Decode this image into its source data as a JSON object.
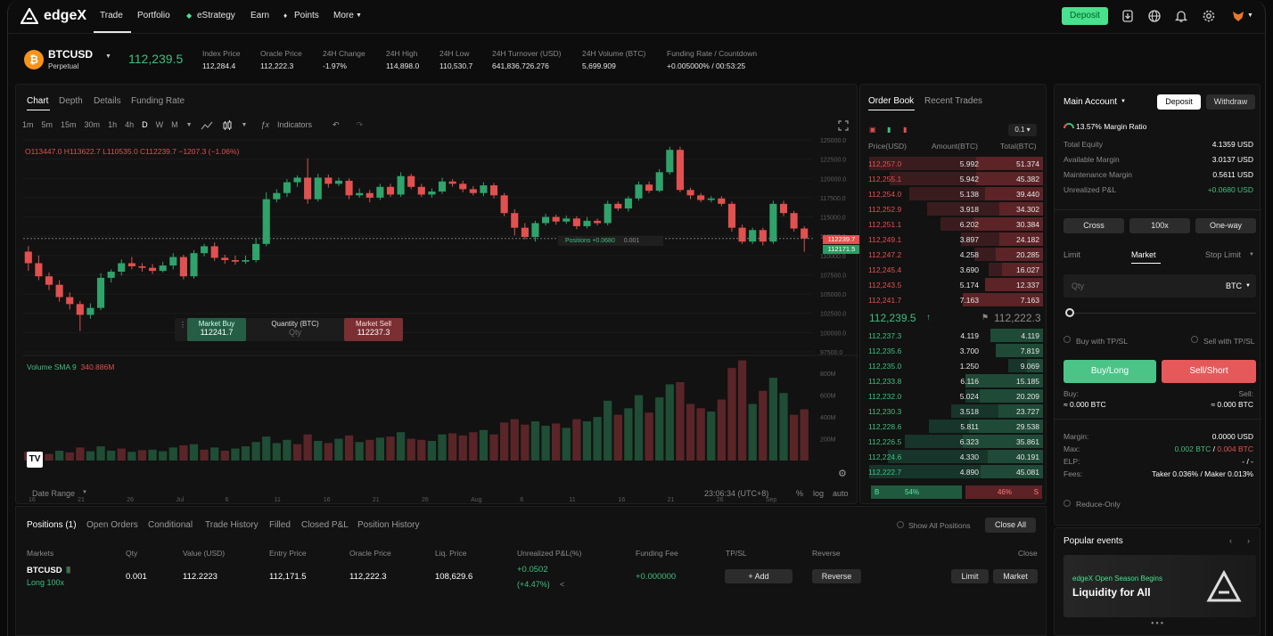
{
  "nav": {
    "logo": "edgeX",
    "items": [
      "Trade",
      "Portfolio",
      "eStrategy",
      "Earn",
      "Points",
      "More"
    ],
    "deposit": "Deposit"
  },
  "ticker": {
    "symbol": "BTCUSD",
    "sub": "Perpetual",
    "price": "112,239.5",
    "stats": [
      {
        "label": "Index Price",
        "value": "112,284.4"
      },
      {
        "label": "Oracle Price",
        "value": "112,222.3"
      },
      {
        "label": "24H Change",
        "value": "-1.97%"
      },
      {
        "label": "24H High",
        "value": "114,898.0"
      },
      {
        "label": "24H Low",
        "value": "110,530.7"
      },
      {
        "label": "24H Turnover (USD)",
        "value": "641,836,726.276"
      },
      {
        "label": "24H Volume (BTC)",
        "value": "5,699.909"
      },
      {
        "label": "Funding Rate / Countdown",
        "value": "+0.005000% / 00:53:25"
      }
    ]
  },
  "chart": {
    "tabs": [
      "Chart",
      "Depth",
      "Details",
      "Funding Rate"
    ],
    "intervals": [
      "1m",
      "5m",
      "15m",
      "30m",
      "1h",
      "4h",
      "D",
      "W",
      "M"
    ],
    "indicators": "Indicators",
    "ohlc": "O113447.0 H113622.7 L110535.0 C112239.7 −1207.3 (−1.06%)",
    "volume_label": "Volume SMA 9",
    "volume_value": "340.886M",
    "positions_label": "Positions +0.0680",
    "positions_qty": "0.001",
    "price_tag_1": "112239.7",
    "price_tag_2": "112171.5",
    "price_axis": [
      "125000.0",
      "122500.0",
      "120000.0",
      "117500.0",
      "115000.0",
      "112500.0",
      "110000.0",
      "107500.0",
      "105000.0",
      "102500.0",
      "100000.0",
      "97500.0"
    ],
    "vol_axis": [
      "800M",
      "600M",
      "400M",
      "200M"
    ],
    "date_axis": [
      "16",
      "21",
      "26",
      "Jul",
      "6",
      "11",
      "16",
      "21",
      "26",
      "Aug",
      "6",
      "11",
      "16",
      "21",
      "26",
      "Sep"
    ],
    "quick_trade": {
      "buy_label": "Market Buy",
      "buy_price": "112241.7",
      "qty_label": "Quantity (BTC)",
      "qty_placeholder": "Qty",
      "sell_label": "Market Sell",
      "sell_price": "112237.3"
    },
    "date_range": "Date Range",
    "time": "23:06:34 (UTC+8)",
    "percent": "%",
    "log": "log",
    "auto": "auto"
  },
  "chart_data": {
    "type": "candlestick",
    "ylim": [
      97500,
      125000
    ],
    "candles": [
      [
        110500,
        109000,
        111200,
        108000
      ],
      [
        109000,
        107300,
        110000,
        106800
      ],
      [
        107300,
        106200,
        107800,
        105500
      ],
      [
        106200,
        104600,
        106800,
        104000
      ],
      [
        104600,
        103700,
        105200,
        103000
      ],
      [
        103700,
        102300,
        104100,
        100200
      ],
      [
        102300,
        103200,
        103800,
        101800
      ],
      [
        103200,
        107100,
        107700,
        102900
      ],
      [
        107100,
        107900,
        108200,
        106500
      ],
      [
        107900,
        109000,
        109500,
        107400
      ],
      [
        109000,
        108600,
        109800,
        108200
      ],
      [
        108600,
        108400,
        109000,
        107900
      ],
      [
        108400,
        108000,
        108900,
        107600
      ],
      [
        108000,
        108700,
        109200,
        107800
      ],
      [
        108700,
        109800,
        110300,
        108200
      ],
      [
        109800,
        107300,
        110100,
        106900
      ],
      [
        107300,
        110300,
        110700,
        107000
      ],
      [
        110300,
        111200,
        111500,
        109900
      ],
      [
        111200,
        109700,
        111700,
        109300
      ],
      [
        109700,
        109400,
        110100,
        108900
      ],
      [
        109400,
        109200,
        110000,
        108800
      ],
      [
        109200,
        109400,
        110000,
        108900
      ],
      [
        109400,
        111500,
        112200,
        109100
      ],
      [
        111500,
        117300,
        118200,
        111200
      ],
      [
        117300,
        118100,
        118600,
        116900
      ],
      [
        118100,
        119500,
        119900,
        117600
      ],
      [
        119500,
        120100,
        120400,
        118900
      ],
      [
        120100,
        117300,
        122600,
        116700
      ],
      [
        117300,
        120100,
        120600,
        117000
      ],
      [
        120100,
        119300,
        120500,
        118800
      ],
      [
        119300,
        119700,
        120100,
        119000
      ],
      [
        119700,
        117800,
        120000,
        117300
      ],
      [
        117800,
        118100,
        118700,
        117500
      ],
      [
        118100,
        117500,
        118500,
        116900
      ],
      [
        117500,
        118900,
        119300,
        117200
      ],
      [
        118900,
        117900,
        119300,
        117600
      ],
      [
        117900,
        120300,
        120800,
        117600
      ],
      [
        120300,
        118900,
        120600,
        118600
      ],
      [
        118900,
        117900,
        119300,
        117600
      ],
      [
        117900,
        118300,
        118700,
        117500
      ],
      [
        118300,
        119600,
        120100,
        118000
      ],
      [
        119600,
        119300,
        119900,
        118900
      ],
      [
        119300,
        118600,
        119700,
        118200
      ],
      [
        118600,
        118100,
        119000,
        117800
      ],
      [
        118100,
        119100,
        119500,
        117700
      ],
      [
        119100,
        117800,
        119400,
        117400
      ],
      [
        117800,
        115500,
        118100,
        115100
      ],
      [
        115500,
        113600,
        116000,
        112600
      ],
      [
        113600,
        112400,
        114200,
        112100
      ],
      [
        112400,
        114200,
        114500,
        111800
      ],
      [
        114200,
        115000,
        115400,
        113900
      ],
      [
        115000,
        114400,
        115300,
        114000
      ],
      [
        114400,
        114800,
        115200,
        114100
      ],
      [
        114800,
        113800,
        115100,
        113400
      ],
      [
        113800,
        114500,
        115000,
        113500
      ],
      [
        114500,
        114200,
        114800,
        113900
      ],
      [
        114200,
        116700,
        117100,
        113900
      ],
      [
        116700,
        116100,
        117000,
        115800
      ],
      [
        116100,
        117400,
        117700,
        115700
      ],
      [
        117400,
        119200,
        119600,
        117100
      ],
      [
        119200,
        118400,
        119600,
        118100
      ],
      [
        118400,
        120800,
        121200,
        118200
      ],
      [
        120800,
        123700,
        124100,
        120500
      ],
      [
        123700,
        118500,
        124100,
        118200
      ],
      [
        118500,
        117800,
        118800,
        117300
      ],
      [
        117800,
        117200,
        118100,
        116900
      ],
      [
        117200,
        117400,
        117700,
        116900
      ],
      [
        117400,
        116700,
        117700,
        116400
      ],
      [
        116700,
        113600,
        117000,
        113100
      ],
      [
        113600,
        111800,
        114000,
        111500
      ],
      [
        111800,
        113300,
        113600,
        111500
      ],
      [
        113300,
        111800,
        113600,
        111300
      ],
      [
        111800,
        116700,
        117100,
        111500
      ],
      [
        116700,
        115500,
        117100,
        115100
      ],
      [
        115500,
        113500,
        115800,
        113100
      ],
      [
        113500,
        112200,
        113800,
        110500
      ]
    ],
    "volumes": [
      [
        80,
        0
      ],
      [
        70,
        0
      ],
      [
        60,
        0
      ],
      [
        90,
        1
      ],
      [
        75,
        0
      ],
      [
        120,
        0
      ],
      [
        85,
        1
      ],
      [
        130,
        1
      ],
      [
        90,
        1
      ],
      [
        110,
        0
      ],
      [
        80,
        1
      ],
      [
        95,
        0
      ],
      [
        100,
        1
      ],
      [
        85,
        1
      ],
      [
        120,
        1
      ],
      [
        140,
        0
      ],
      [
        150,
        1
      ],
      [
        100,
        0
      ],
      [
        120,
        1
      ],
      [
        90,
        0
      ],
      [
        110,
        1
      ],
      [
        130,
        1
      ],
      [
        170,
        1
      ],
      [
        220,
        1
      ],
      [
        160,
        1
      ],
      [
        190,
        1
      ],
      [
        150,
        0
      ],
      [
        240,
        0
      ],
      [
        180,
        1
      ],
      [
        160,
        0
      ],
      [
        200,
        1
      ],
      [
        230,
        0
      ],
      [
        170,
        1
      ],
      [
        190,
        0
      ],
      [
        210,
        1
      ],
      [
        220,
        0
      ],
      [
        260,
        1
      ],
      [
        200,
        0
      ],
      [
        190,
        0
      ],
      [
        180,
        1
      ],
      [
        240,
        1
      ],
      [
        250,
        0
      ],
      [
        230,
        0
      ],
      [
        260,
        0
      ],
      [
        280,
        1
      ],
      [
        240,
        0
      ],
      [
        350,
        0
      ],
      [
        380,
        0
      ],
      [
        330,
        0
      ],
      [
        360,
        1
      ],
      [
        320,
        1
      ],
      [
        340,
        0
      ],
      [
        300,
        1
      ],
      [
        380,
        0
      ],
      [
        360,
        1
      ],
      [
        400,
        1
      ],
      [
        550,
        1
      ],
      [
        420,
        0
      ],
      [
        480,
        1
      ],
      [
        600,
        1
      ],
      [
        440,
        0
      ],
      [
        580,
        1
      ],
      [
        700,
        1
      ],
      [
        720,
        0
      ],
      [
        520,
        0
      ],
      [
        480,
        0
      ],
      [
        450,
        1
      ],
      [
        560,
        0
      ],
      [
        850,
        0
      ],
      [
        920,
        0
      ],
      [
        520,
        1
      ],
      [
        640,
        0
      ],
      [
        760,
        1
      ],
      [
        620,
        1
      ],
      [
        420,
        0
      ],
      [
        470,
        0
      ]
    ],
    "volume_ylim": [
      0,
      900
    ]
  },
  "orderbook": {
    "tabs": [
      "Order Book",
      "Recent Trades"
    ],
    "precision": "0.1",
    "headers": [
      "Price(USD)",
      "Amount(BTC)",
      "Total(BTC)"
    ],
    "asks": [
      [
        "112,257.0",
        "5.992",
        "51.374"
      ],
      [
        "112,255.1",
        "5.942",
        "45.382"
      ],
      [
        "112,254.0",
        "5.138",
        "39.440"
      ],
      [
        "112,252.9",
        "3.918",
        "34.302"
      ],
      [
        "112,251.1",
        "6.202",
        "30.384"
      ],
      [
        "112,249.1",
        "3.897",
        "24.182"
      ],
      [
        "112,247.2",
        "4.258",
        "20.285"
      ],
      [
        "112,245.4",
        "3.690",
        "16.027"
      ],
      [
        "112,243.5",
        "5.174",
        "12.337"
      ],
      [
        "112,241.7",
        "7.163",
        "7.163"
      ]
    ],
    "mid_price": "112,239.5",
    "mark_price": "112,222.3",
    "bids": [
      [
        "112,237.3",
        "4.119",
        "4.119"
      ],
      [
        "112,235.6",
        "3.700",
        "7.819"
      ],
      [
        "112,235.0",
        "1.250",
        "9.069"
      ],
      [
        "112,233.8",
        "6.116",
        "15.185"
      ],
      [
        "112,232.0",
        "5.024",
        "20.209"
      ],
      [
        "112,230.3",
        "3.518",
        "23.727"
      ],
      [
        "112,228.6",
        "5.811",
        "29.538"
      ],
      [
        "112,226.5",
        "6.323",
        "35.861"
      ],
      [
        "112,224.6",
        "4.330",
        "40.191"
      ],
      [
        "112,222.7",
        "4.890",
        "45.081"
      ]
    ],
    "ratio_buy": "54%",
    "ratio_sell": "46%",
    "ratio_b": "B",
    "ratio_s": "S",
    "ratio_buy_frac": 0.54
  },
  "account": {
    "title": "Main Account",
    "deposit": "Deposit",
    "withdraw": "Withdraw",
    "margin_ratio": "13.57% Margin Ratio",
    "rows": [
      {
        "label": "Total Equity",
        "value": "4.1359 USD"
      },
      {
        "label": "Available Margin",
        "value": "3.0137 USD"
      },
      {
        "label": "Maintenance Margin",
        "value": "0.5611 USD"
      },
      {
        "label": "Unrealized P&L",
        "value": "+0.0680 USD"
      }
    ]
  },
  "order_form": {
    "mode": [
      "Cross",
      "100x",
      "One-way"
    ],
    "types": [
      "Limit",
      "Market",
      "Stop Limit"
    ],
    "qty_placeholder": "Qty",
    "qty_unit": "BTC",
    "buy_tpsl": "Buy with TP/SL",
    "sell_tpsl": "Sell with TP/SL",
    "buy_btn": "Buy/Long",
    "sell_btn": "Sell/Short",
    "buy_label": "Buy:",
    "sell_label": "Sell:",
    "buy_amt": "≈ 0.000 BTC",
    "sell_amt": "≈ 0.000 BTC",
    "margin_label": "Margin:",
    "margin_val": "0.0000 USD",
    "max_label": "Max:",
    "max_buy": "0.002 BTC",
    "max_sep": "/",
    "max_sell": "0.004 BTC",
    "elp_label": "ELP:",
    "elp_val": "- / -",
    "fees_label": "Fees:",
    "fees_val": "Taker 0.036% / Maker 0.013%",
    "reduce_only": "Reduce-Only"
  },
  "events": {
    "title": "Popular events",
    "banner_line1": "edgeX Open Season Begins",
    "banner_line2": "Liquidity for All"
  },
  "positions": {
    "tabs": [
      "Positions (1)",
      "Open Orders",
      "Conditional",
      "Trade History",
      "Filled",
      "Closed P&L",
      "Position History"
    ],
    "show_all": "Show All Positions",
    "close_all": "Close All",
    "headers": [
      "Markets",
      "Qty",
      "Value (USD)",
      "Entry Price",
      "Oracle Price",
      "Liq. Price",
      "Unrealized P&L(%)",
      "Funding Fee",
      "TP/SL",
      "Reverse",
      "Close"
    ],
    "row": {
      "market": "BTCUSD",
      "side": "Long 100x",
      "qty": "0.001",
      "value": "112.2223",
      "entry": "112,171.5",
      "oracle": "112,222.3",
      "liq": "108,629.6",
      "pnl": "+0.0502",
      "pnl_pct": "(+4.47%)",
      "funding": "+0.000000",
      "tpsl": "+ Add",
      "reverse": "Reverse",
      "limit": "Limit",
      "market_btn": "Market"
    }
  }
}
